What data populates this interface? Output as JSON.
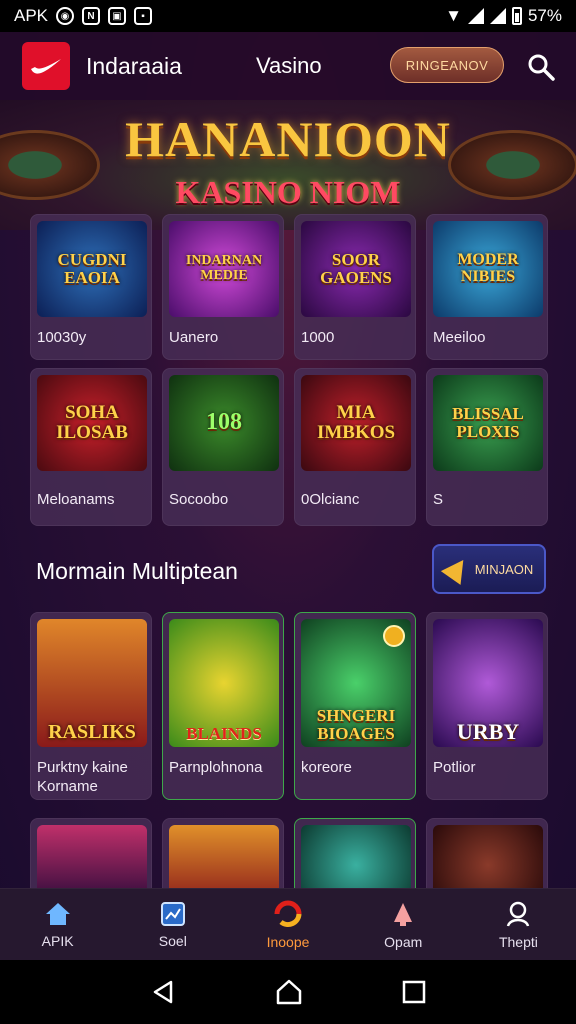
{
  "status_bar": {
    "carrier": "APK",
    "battery": "57%"
  },
  "header": {
    "app_name": "Indaraaia",
    "center_link": "Vasino",
    "pill_button": "RINGEANOV"
  },
  "hero": {
    "title": "HANANIOON",
    "subtitle": "KASINO NIOM"
  },
  "games_row1": [
    {
      "thumb": "CUGDNI EAOIA",
      "label": "10030y"
    },
    {
      "thumb": "INDARNAN MEDIE",
      "label": "Uanero"
    },
    {
      "thumb": "SOOR GAOENS",
      "label": "1000"
    },
    {
      "thumb": "MODER NIBIES",
      "label": "Meeiloo"
    }
  ],
  "games_row2": [
    {
      "thumb": "SOHA ILOSAB",
      "label": "Meloanams"
    },
    {
      "thumb": "108",
      "label": "Socoobo"
    },
    {
      "thumb": "MIA IMBKOS",
      "label": "0Olcianc"
    },
    {
      "thumb": "BLISSAL PLOXIS",
      "label": "S"
    }
  ],
  "section": {
    "title": "Mormain Multiptean",
    "more_button": "MINJAON"
  },
  "games_row3": [
    {
      "thumb": "RASLIKS",
      "label": "Purktny kaine Korname"
    },
    {
      "thumb": "BLAINDS",
      "label": "Parnplohnona"
    },
    {
      "thumb": "SHNGERI BIOAGES",
      "label": "koreore"
    },
    {
      "thumb": "URBY",
      "label": "Potlior"
    }
  ],
  "bottom_nav": [
    {
      "label": "APIK",
      "icon": "home-icon"
    },
    {
      "label": "Soel",
      "icon": "image-icon"
    },
    {
      "label": "Inoope",
      "icon": "ring-icon"
    },
    {
      "label": "Opam",
      "icon": "bell-icon"
    },
    {
      "label": "Thepti",
      "icon": "user-icon"
    }
  ],
  "colors": {
    "accent": "#ff9a3c",
    "brand_red": "#e0102a",
    "gold": "#f9c640"
  }
}
